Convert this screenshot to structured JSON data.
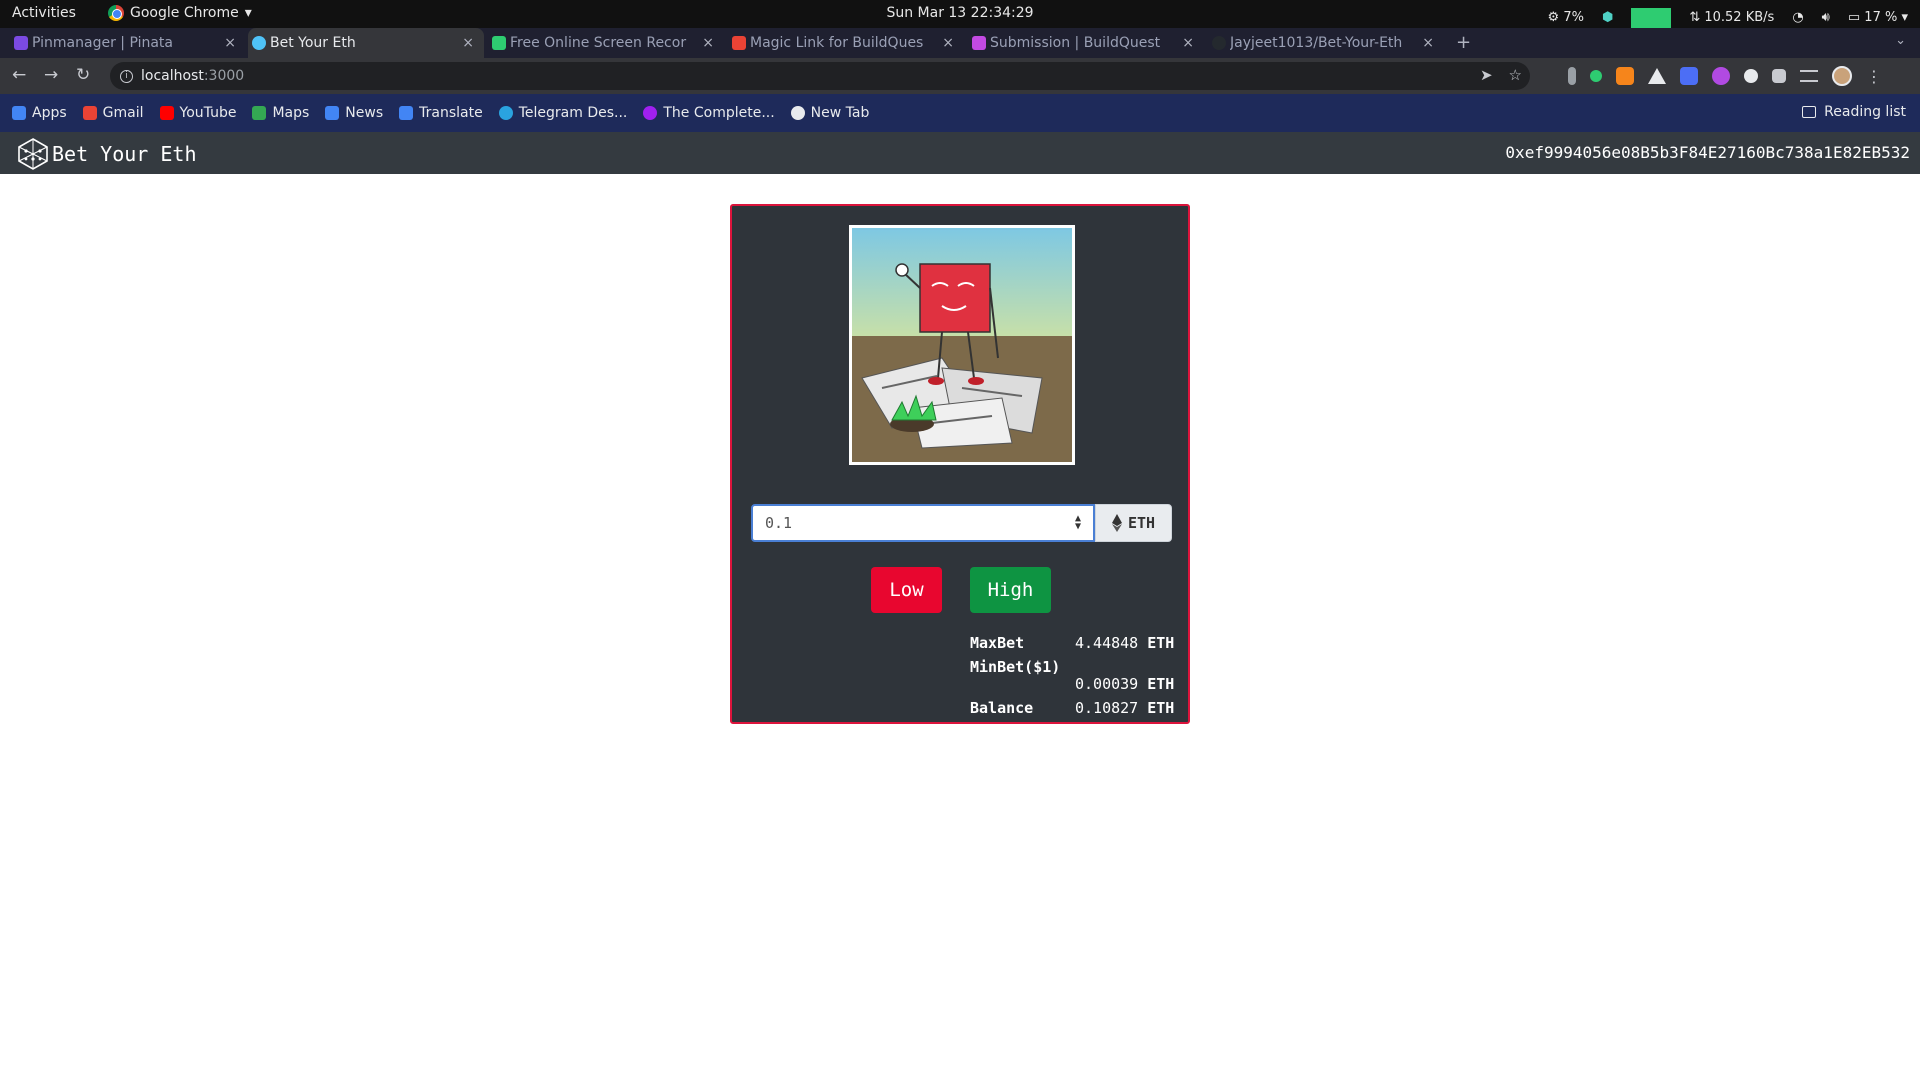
{
  "system": {
    "activities": "Activities",
    "app_name": "Google Chrome",
    "clock": "Sun Mar 13  22:34:29",
    "cpu": "7%",
    "net_speed": "⇅ 10.52 KB/s",
    "battery": "17 %"
  },
  "tabs": [
    {
      "label": "Pinmanager | Pinata",
      "favicon_color": "#7b4ae2"
    },
    {
      "label": "Bet Your Eth",
      "favicon_color": "#4fc3f7",
      "active": true
    },
    {
      "label": "Free Online Screen Recor",
      "favicon_color": "#2ecc71"
    },
    {
      "label": "Magic Link for BuildQues",
      "favicon_color": "#ea4335"
    },
    {
      "label": "Submission | BuildQuest",
      "favicon_color": "#c34ae2"
    },
    {
      "label": "Jayjeet1013/Bet-Your-Eth",
      "favicon_color": "#24292e"
    }
  ],
  "address_bar": {
    "host": "localhost",
    "port": ":3000"
  },
  "bookmarks": [
    {
      "label": "Apps",
      "color": "#4285f4"
    },
    {
      "label": "Gmail",
      "color": "#ea4335"
    },
    {
      "label": "YouTube",
      "color": "#ff0000"
    },
    {
      "label": "Maps",
      "color": "#34a853"
    },
    {
      "label": "News",
      "color": "#4285f4"
    },
    {
      "label": "Translate",
      "color": "#4285f4"
    },
    {
      "label": "Telegram Des...",
      "color": "#2aa3df"
    },
    {
      "label": "The Complete...",
      "color": "#a020f0"
    },
    {
      "label": "New Tab",
      "color": "#e8eaed"
    }
  ],
  "reading_list": "Reading list",
  "app": {
    "brand": "Bet Your Eth",
    "account": "0xef9994056e08B5b3F84E27160Bc738a1E82EB532"
  },
  "bet": {
    "amount": "0.1",
    "currency": "ETH",
    "low_label": "Low",
    "high_label": "High"
  },
  "stats": {
    "maxbet_label": "MaxBet",
    "maxbet_value": "4.44848",
    "minbet_label": "MinBet($1)",
    "minbet_value": "0.00039",
    "balance_label": "Balance",
    "balance_value": "0.10827",
    "unit": "ETH"
  },
  "colors": {
    "card_bg": "#2f343a",
    "card_border": "#dc143c",
    "low_button": "#e8062f",
    "high_button": "#0e9442",
    "navbar": "#343a40"
  }
}
